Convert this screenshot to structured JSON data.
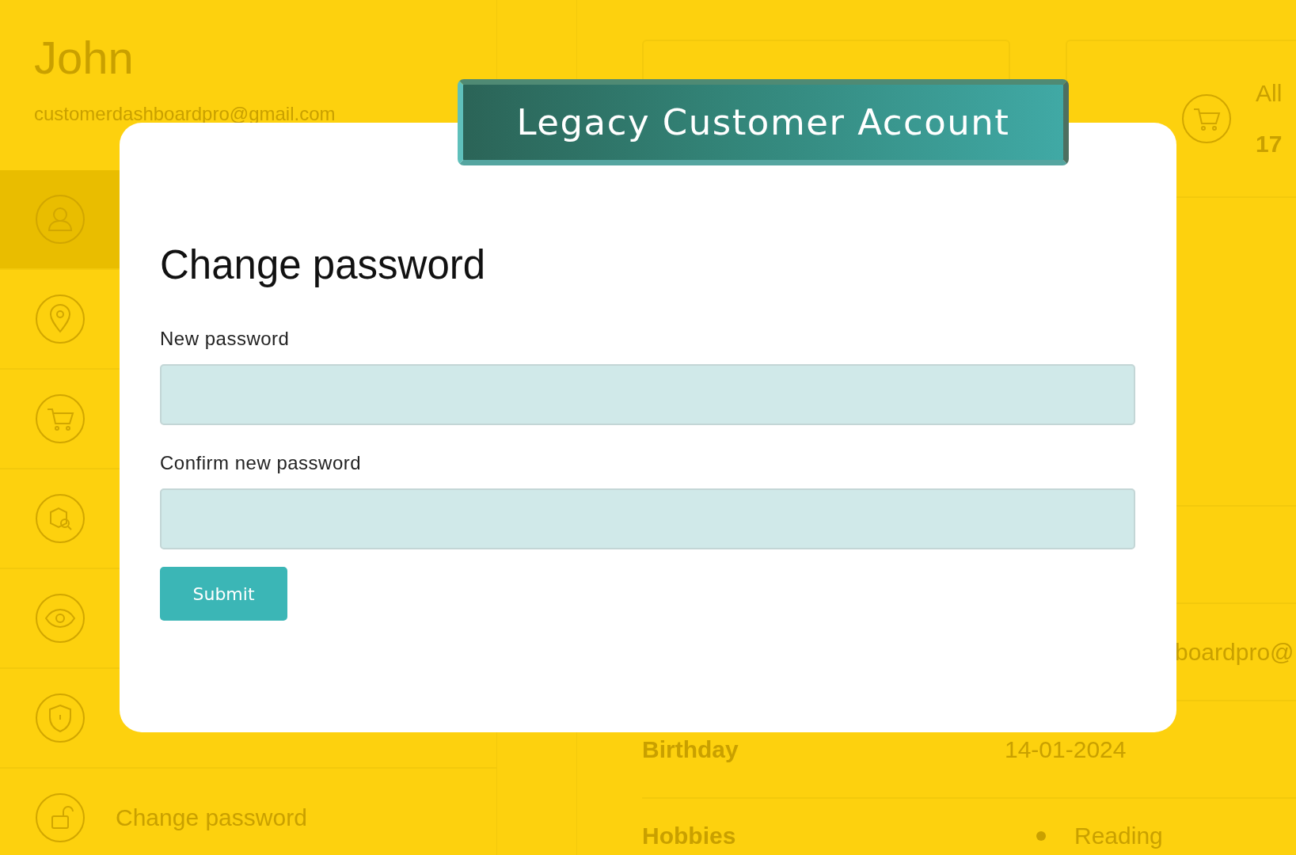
{
  "background": {
    "profile": {
      "name": "John",
      "email": "customerdashboardpro@gmail.com"
    },
    "sidebar": {
      "items": [
        {
          "kind": "user",
          "selected": true
        },
        {
          "kind": "pin",
          "selected": false
        },
        {
          "kind": "cart",
          "selected": false
        },
        {
          "kind": "package",
          "selected": false
        },
        {
          "kind": "eye",
          "selected": false
        },
        {
          "kind": "shield",
          "selected": false
        },
        {
          "kind": "lock",
          "selected": false,
          "label": "Change password"
        }
      ]
    },
    "stats_card": {
      "label": "All",
      "count": "17"
    },
    "details": [
      {
        "kind": "text",
        "value": "boardpro@"
      },
      {
        "kind": "text",
        "label": "Birthday",
        "value": "14-01-2024"
      },
      {
        "kind": "list",
        "label": "Hobbies",
        "items": [
          "Reading"
        ]
      }
    ]
  },
  "modal": {
    "banner": "Legacy Customer Account",
    "title": "Change password",
    "fields": [
      {
        "label": "New password"
      },
      {
        "label": "Confirm new password"
      }
    ],
    "button": "Submit"
  }
}
